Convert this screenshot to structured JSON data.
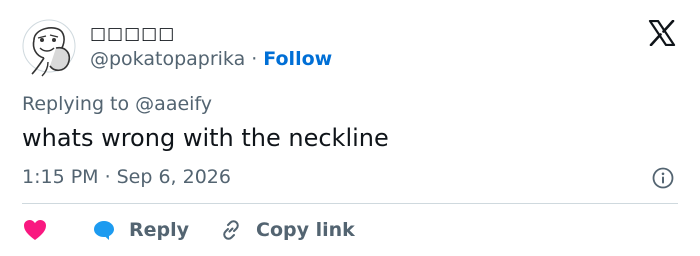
{
  "author": {
    "name": "□□□□□",
    "handle": "@pokatopaprika",
    "follow_label": "Follow"
  },
  "header": {
    "separator": "·"
  },
  "tweet": {
    "replying_prefix": "Replying to",
    "replying_to": "@aaeify",
    "text": "whats wrong with the neckline",
    "time": "1:15 PM",
    "date": "Sep 6, 2026"
  },
  "actions": {
    "reply_label": "Reply",
    "copy_link_label": "Copy link"
  },
  "colors": {
    "like": "#f91880",
    "reply": "#1d9bf0",
    "link": "#006fd6",
    "muted": "#536471",
    "divider": "#cfd9de"
  },
  "icons": [
    "avatar",
    "x-logo-icon",
    "info-icon",
    "heart-icon",
    "reply-bubble-icon",
    "link-icon"
  ]
}
